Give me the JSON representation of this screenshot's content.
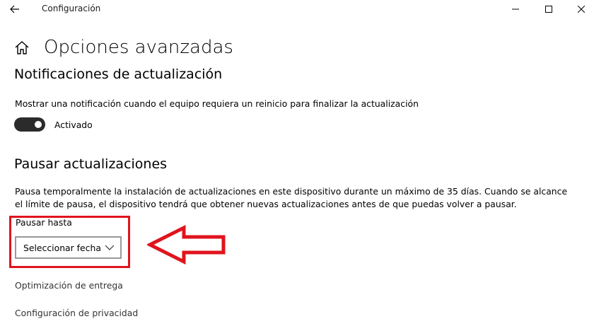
{
  "titlebar": {
    "title": "Configuración",
    "back_icon": "arrow-left-icon",
    "minimize_icon": "minimize-icon",
    "maximize_icon": "maximize-icon",
    "close_icon": "close-icon"
  },
  "page": {
    "home_icon": "home-icon",
    "title": "Opciones avanzadas"
  },
  "notifications": {
    "heading": "Notificaciones de actualización",
    "description": "Mostrar una notificación cuando el equipo requiera un reinicio para finalizar la actualización",
    "toggle_state": "on",
    "toggle_label": "Activado"
  },
  "pause": {
    "heading": "Pausar actualizaciones",
    "description": "Pausa temporalmente la instalación de actualizaciones en este dispositivo durante un máximo de 35 días. Cuando se alcance el límite de pausa, el dispositivo tendrá que obtener nuevas actualizaciones antes de que puedas volver a pausar.",
    "until_label": "Pausar hasta",
    "dropdown_value": "Seleccionar fecha",
    "dropdown_icon": "chevron-down-icon"
  },
  "annotation": {
    "highlight_color": "#e0141e",
    "arrow_icon": "red-arrow-left-icon"
  },
  "links": {
    "delivery_optimization": "Optimización de entrega",
    "privacy_settings": "Configuración de privacidad"
  },
  "colors": {
    "toggle_on": "#2b2b2b",
    "background": "#ffffff"
  }
}
